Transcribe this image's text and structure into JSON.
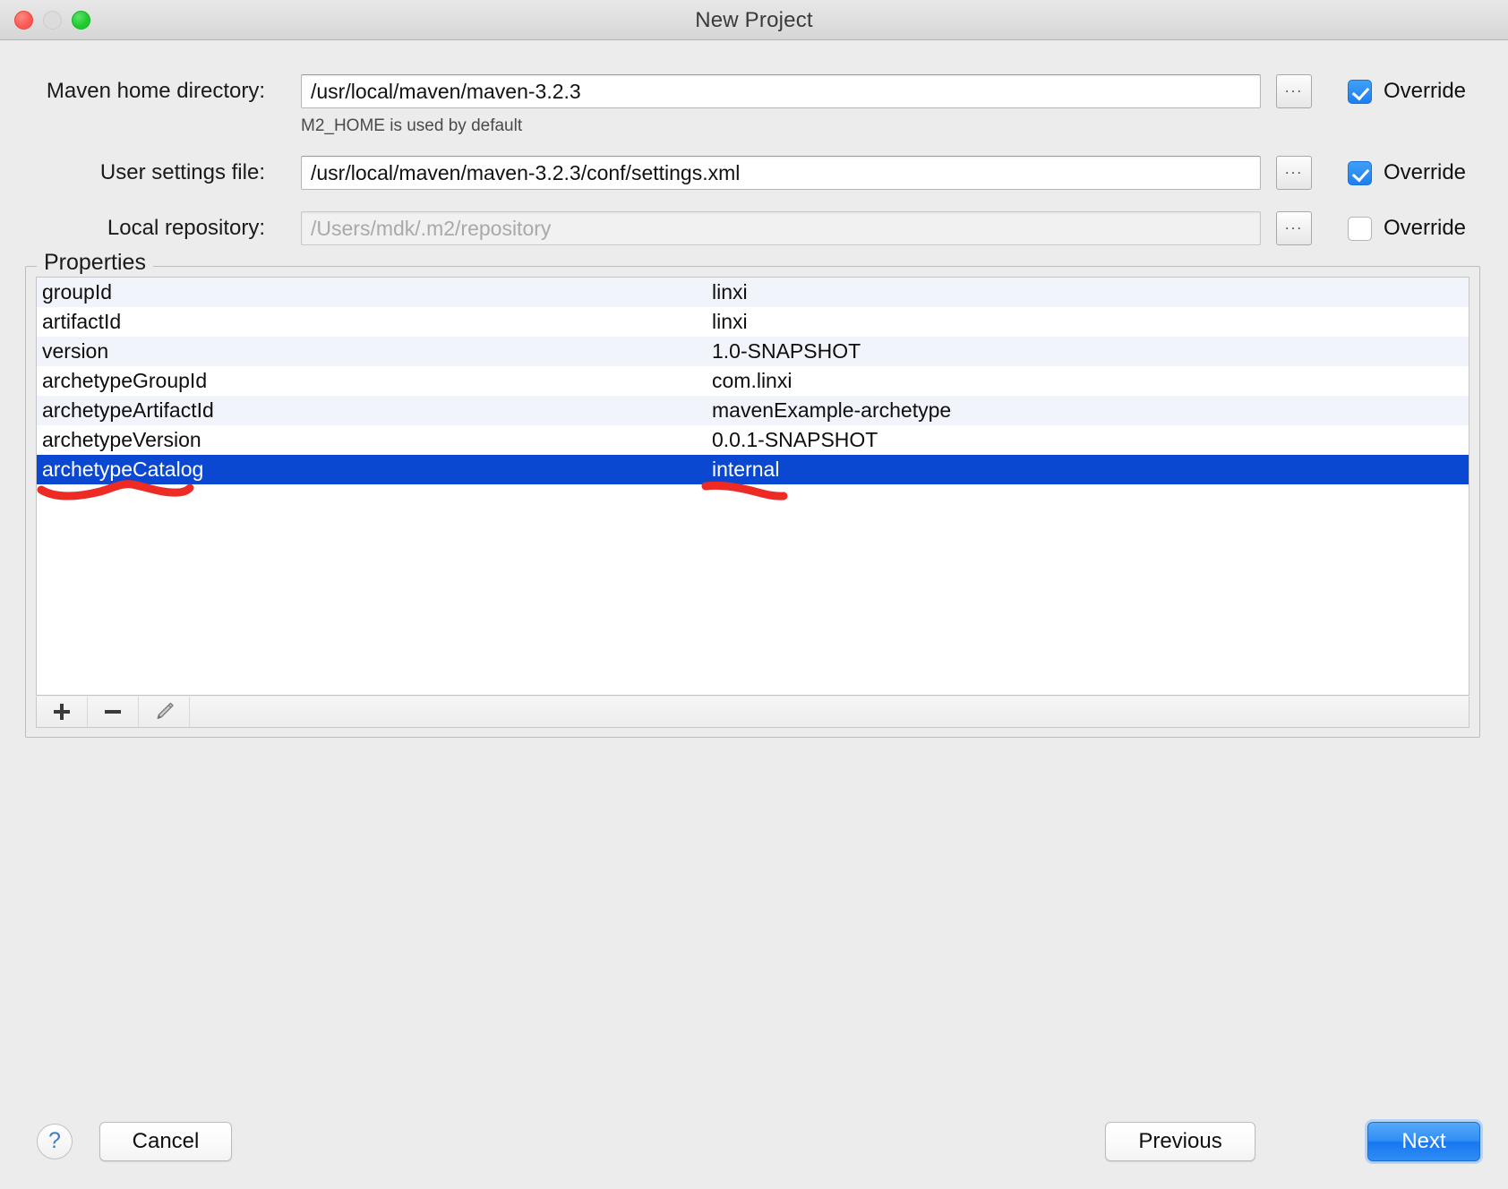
{
  "window": {
    "title": "New Project",
    "controls": {
      "close": "close-button",
      "minimize": "minimize-button",
      "zoom": "zoom-button"
    }
  },
  "form": {
    "rows": [
      {
        "label": "Maven home directory:",
        "value": "/usr/local/maven/maven-3.2.3",
        "placeholder": "",
        "disabled": false,
        "browse": "...",
        "override_label": "Override",
        "override_checked": true,
        "hint": "M2_HOME is used by default"
      },
      {
        "label": "User settings file:",
        "value": "/usr/local/maven/maven-3.2.3/conf/settings.xml",
        "placeholder": "",
        "disabled": false,
        "browse": "...",
        "override_label": "Override",
        "override_checked": true,
        "hint": ""
      },
      {
        "label": "Local repository:",
        "value": "",
        "placeholder": "/Users/mdk/.m2/repository",
        "disabled": true,
        "browse": "...",
        "override_label": "Override",
        "override_checked": false,
        "hint": ""
      }
    ]
  },
  "properties": {
    "group_title": "Properties",
    "rows": [
      {
        "key": "groupId",
        "value": "linxi",
        "selected": false
      },
      {
        "key": "artifactId",
        "value": "linxi",
        "selected": false
      },
      {
        "key": "version",
        "value": "1.0-SNAPSHOT",
        "selected": false
      },
      {
        "key": "archetypeGroupId",
        "value": "com.linxi",
        "selected": false
      },
      {
        "key": "archetypeArtifactId",
        "value": "mavenExample-archetype",
        "selected": false
      },
      {
        "key": "archetypeVersion",
        "value": "0.0.1-SNAPSHOT",
        "selected": false
      },
      {
        "key": "archetypeCatalog",
        "value": "internal",
        "selected": true
      }
    ],
    "toolbar": [
      {
        "name": "add-property-button",
        "icon": "plus-icon"
      },
      {
        "name": "remove-property-button",
        "icon": "minus-icon"
      },
      {
        "name": "edit-property-button",
        "icon": "pencil-icon"
      }
    ]
  },
  "annotations": {
    "color": "#ee2a24",
    "marks": [
      {
        "name": "underline-archetype-catalog-key",
        "target": "archetypeCatalog"
      },
      {
        "name": "underline-archetype-catalog-value",
        "target": "internal"
      }
    ]
  },
  "footer": {
    "help_label": "?",
    "cancel_label": "Cancel",
    "previous_label": "Previous",
    "next_label": "Next"
  },
  "colors": {
    "selection_blue": "#0b48d2",
    "accent_blue": "#1d7ff0",
    "annotation_red": "#ee2a24",
    "window_bg": "#ececec"
  }
}
